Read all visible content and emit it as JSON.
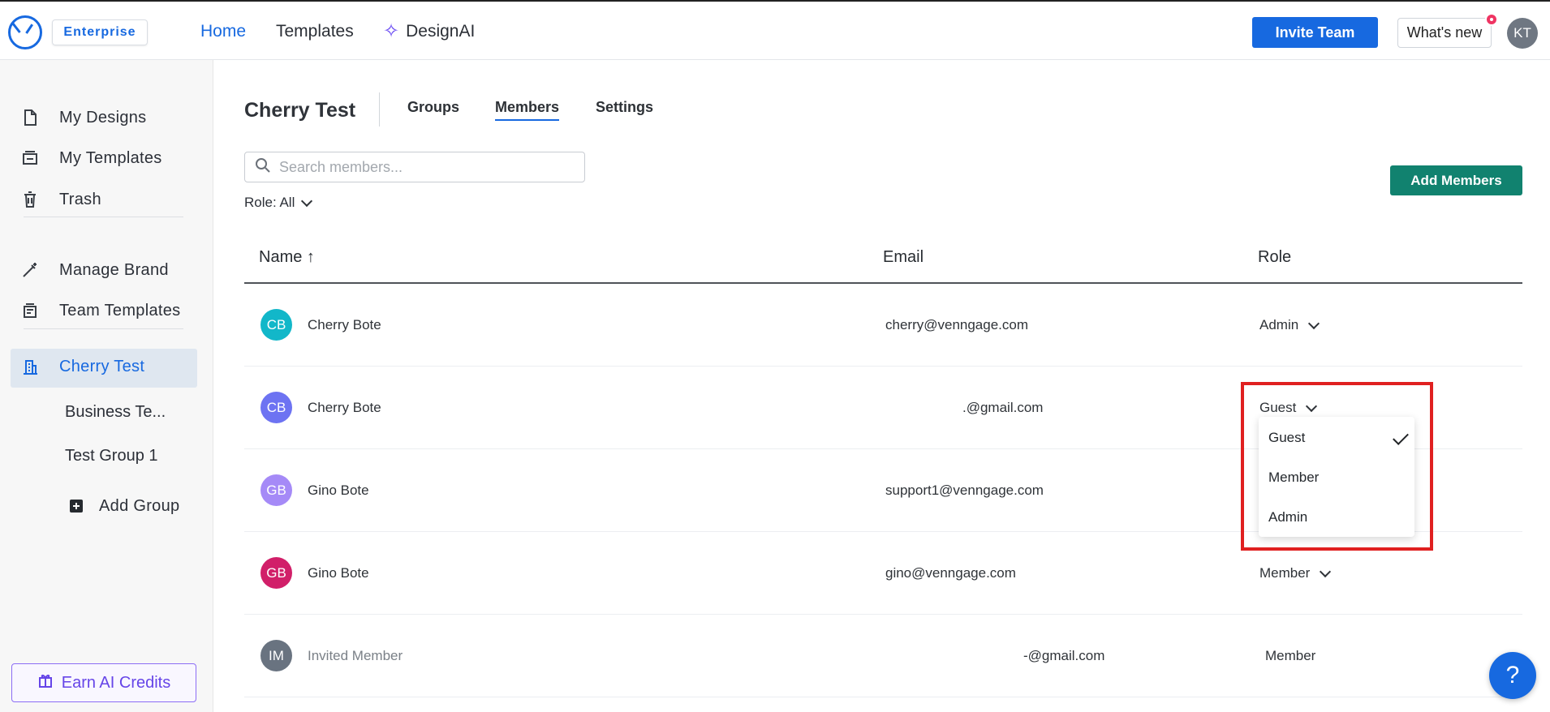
{
  "topbar": {
    "plan_badge": "Enterprise",
    "nav": [
      "Home",
      "Templates",
      "DesignAI"
    ],
    "invite_label": "Invite Team",
    "whats_new_label": "What's new",
    "user_initials": "KT"
  },
  "sidebar": {
    "items": [
      "My Designs",
      "My Templates",
      "Trash",
      "Manage Brand",
      "Team Templates"
    ],
    "team_name": "Cherry Test",
    "sub_items": [
      "Business Te...",
      "Test Group 1",
      "Add Group"
    ],
    "earn_label": "Earn AI Credits"
  },
  "main": {
    "title": "Cherry Test",
    "tabs": [
      "Groups",
      "Members",
      "Settings"
    ],
    "search_placeholder": "Search members...",
    "role_filter": "Role: All",
    "add_members_label": "Add Members",
    "headers": {
      "name": "Name",
      "sort_arrow": "↑",
      "email": "Email",
      "role": "Role"
    },
    "rows": [
      {
        "initials": "CB",
        "name": "Cherry Bote",
        "email": "cherry@venngage.com",
        "role": "Admin",
        "color": "#12b7c9"
      },
      {
        "initials": "CB",
        "name": "Cherry Bote",
        "email": ".@gmail.com",
        "role": "Guest",
        "color": "#6d73f2"
      },
      {
        "initials": "GB",
        "name": "Gino Bote",
        "email": "support1@venngage.com",
        "role": "",
        "color": "#a58af7"
      },
      {
        "initials": "GB",
        "name": "Gino Bote",
        "email": "gino@venngage.com",
        "role": "Member",
        "color": "#d11f69"
      },
      {
        "initials": "IM",
        "name": "Invited Member",
        "email": "-@gmail.com",
        "role": "Member",
        "color": "#697380"
      }
    ],
    "dropdown_options": [
      "Guest",
      "Member",
      "Admin"
    ]
  },
  "help_label": "?"
}
